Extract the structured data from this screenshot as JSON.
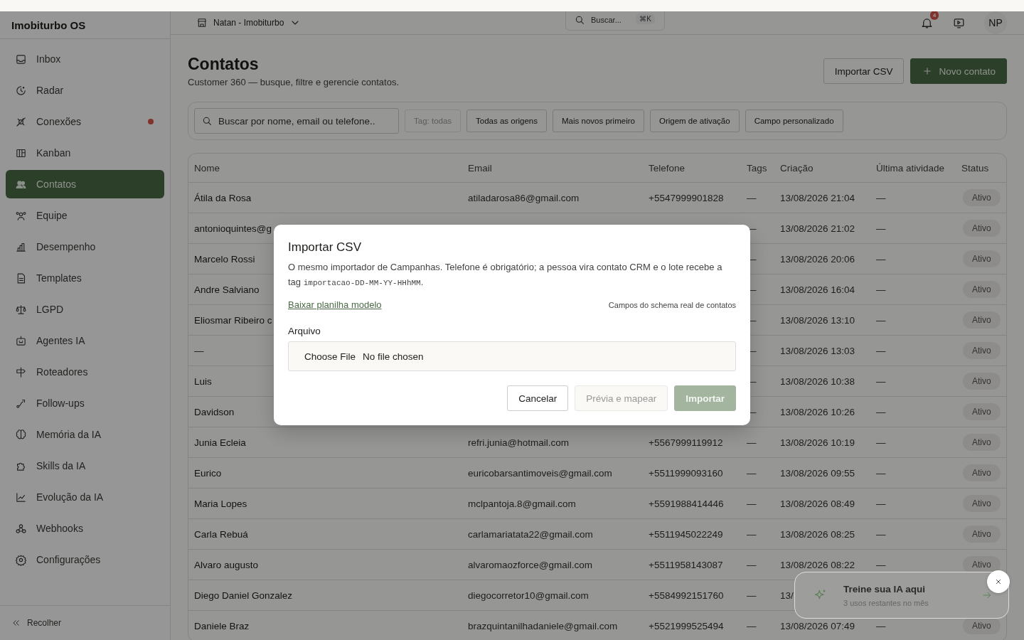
{
  "brand": "Imobiturbo OS",
  "sidebar": {
    "items": [
      {
        "label": "Inbox",
        "selected": false,
        "dot": false
      },
      {
        "label": "Radar",
        "selected": false,
        "dot": false
      },
      {
        "label": "Conexões",
        "selected": false,
        "dot": true
      },
      {
        "label": "Kanban",
        "selected": false,
        "dot": false
      },
      {
        "label": "Contatos",
        "selected": true,
        "dot": false
      },
      {
        "label": "Equipe",
        "selected": false,
        "dot": false
      },
      {
        "label": "Desempenho",
        "selected": false,
        "dot": false
      },
      {
        "label": "Templates",
        "selected": false,
        "dot": false
      },
      {
        "label": "LGPD",
        "selected": false,
        "dot": false
      },
      {
        "label": "Agentes IA",
        "selected": false,
        "dot": false
      },
      {
        "label": "Roteadores",
        "selected": false,
        "dot": false
      },
      {
        "label": "Follow-ups",
        "selected": false,
        "dot": false
      },
      {
        "label": "Memória da IA",
        "selected": false,
        "dot": false
      },
      {
        "label": "Skills da IA",
        "selected": false,
        "dot": false
      },
      {
        "label": "Evolução da IA",
        "selected": false,
        "dot": false
      },
      {
        "label": "Webhooks",
        "selected": false,
        "dot": false
      },
      {
        "label": "Configurações",
        "selected": false,
        "dot": false
      }
    ],
    "collapse": "Recolher"
  },
  "header": {
    "workspace": "Natan - Imobiturbo",
    "search": {
      "placeholder": "Buscar..."
    },
    "shortcut": "⌘K",
    "notifications": "4",
    "avatar": "NP"
  },
  "page": {
    "title": "Contatos",
    "subtitle": "Customer 360 — busque, filtre e gerencie contatos.",
    "actions": [
      {
        "label": "Importar CSV",
        "kind": "secondary"
      },
      {
        "label": "Novo contato",
        "kind": "primary"
      }
    ]
  },
  "filters": {
    "search": {
      "placeholder": "Buscar por nome, email ou telefone.."
    },
    "chips": [
      {
        "label": "Tag: todas",
        "disabled": true
      },
      {
        "label": "Todas as origens",
        "disabled": false
      },
      {
        "label": "Mais novos primeiro",
        "disabled": false
      },
      {
        "label": "Origem de ativação",
        "disabled": false
      },
      {
        "label": "Campo personalizado",
        "disabled": false
      }
    ]
  },
  "table": {
    "columns": [
      "Nome",
      "Email",
      "Telefone",
      "Tags",
      "Criação",
      "Última atividade",
      "Status"
    ],
    "rows": [
      {
        "name": "Átila da Rosa",
        "email": "atiladarosa86@gmail.com",
        "phone": "+5547999901828",
        "tags": "—",
        "created": "13/08/2026 21:04",
        "last": "—",
        "status": "Ativo"
      },
      {
        "name": "antonioquintes@g",
        "tags": "—",
        "created": "13/08/2026 21:02",
        "last": "—",
        "status": "Ativo"
      },
      {
        "name": "Marcelo Rossi",
        "tags": "—",
        "created": "13/08/2026 20:06",
        "last": "—",
        "status": "Ativo"
      },
      {
        "name": "Andre Salviano",
        "tags": "—",
        "created": "13/08/2026 16:04",
        "last": "—",
        "status": "Ativo"
      },
      {
        "name": "Eliosmar Ribeiro c",
        "tags": "—",
        "created": "13/08/2026 13:10",
        "last": "—",
        "status": "Ativo"
      },
      {
        "name": "—",
        "tags": "—",
        "created": "13/08/2026 13:03",
        "last": "—",
        "status": "Ativo"
      },
      {
        "name": "Luis",
        "tags": "—",
        "created": "13/08/2026 10:38",
        "last": "—",
        "status": "Ativo"
      },
      {
        "name": "Davidson",
        "tags": "—",
        "created": "13/08/2026 10:26",
        "last": "—",
        "status": "Ativo"
      },
      {
        "name": "Junia Ecleia",
        "email": "refri.junia@hotmail.com",
        "phone": "+5567999119912",
        "tags": "—",
        "created": "13/08/2026 10:19",
        "last": "—",
        "status": "Ativo"
      },
      {
        "name": "Eurico",
        "email": "euricobarsantimoveis@gmail.com",
        "phone": "+5511999093160",
        "tags": "—",
        "created": "13/08/2026 09:55",
        "last": "—",
        "status": "Ativo"
      },
      {
        "name": "Maria Lopes",
        "email": "mclpantoja.8@gmail.com",
        "phone": "+5591988414446",
        "tags": "—",
        "created": "13/08/2026 08:49",
        "last": "—",
        "status": "Ativo"
      },
      {
        "name": "Carla Rebuá",
        "email": "carlamariatata22@gmail.com",
        "phone": "+5511945022249",
        "tags": "—",
        "created": "13/08/2026 08:25",
        "last": "—",
        "status": "Ativo"
      },
      {
        "name": "Alvaro augusto",
        "email": "alvaromaozforce@gmail.com",
        "phone": "+5511958143087",
        "tags": "—",
        "created": "13/08/2026 08:22",
        "last": "—",
        "status": "Ativo"
      },
      {
        "name": "Diego Daniel Gonzalez",
        "email": "diegocorretor10@gmail.com",
        "phone": "+5584992151760",
        "tags": "—",
        "created": "13/"
      },
      {
        "name": "Daniele Braz",
        "email": "brazquintanilhadaniele@gmail.com",
        "phone": "+5521999525494",
        "tags": "—",
        "created": "13/08/2026 07:49",
        "last": "—",
        "status": "Ativo"
      }
    ]
  },
  "modal": {
    "title": "Importar CSV",
    "description": {
      "before": "O mesmo importador de Campanhas. Telefone é obrigatório; a pessoa vira contato CRM e o lote recebe a tag ",
      "code": "importacao-DD-MM-YY-HHhMM",
      "after": "."
    },
    "template_link": "Baixar planilha modelo",
    "schema_note": "Campos do schema real de contatos",
    "file_label": "Arquivo",
    "file_button": "Choose File",
    "file_status": "No file chosen",
    "buttons": [
      {
        "label": "Cancelar",
        "kind": "secondary",
        "disabled": false
      },
      {
        "label": "Prévia e mapear",
        "kind": "secondary",
        "disabled": true
      },
      {
        "label": "Importar",
        "kind": "primary",
        "disabled": true
      }
    ]
  },
  "toast": {
    "title": "Treine sua IA aqui",
    "subtitle": "3 usos restantes no mês"
  }
}
